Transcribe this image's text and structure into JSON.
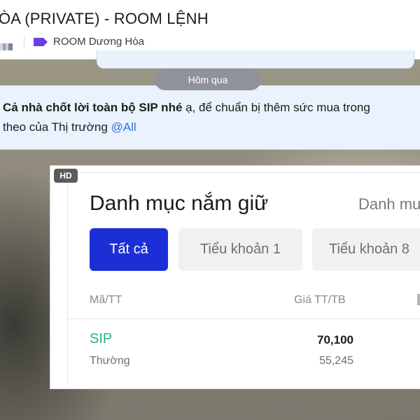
{
  "header": {
    "title": "ÒA (PRIVATE) - ROOM LỆNH",
    "room_name": "ROOM Dương Hòa",
    "tag_color": "#6c3fe0"
  },
  "chat": {
    "date_separator": "Hôm qua",
    "message": {
      "bold_text": "Cả nhà chốt lời toàn bộ SIP nhé",
      "text_after_bold": " ạ, để chuẩn bị thêm sức mua trong",
      "line2_text": "theo của Thị trường ",
      "mention": "@All"
    },
    "image": {
      "quality_badge": "HD",
      "portfolio": {
        "title": "Danh mục nắm giữ",
        "link_text": "Danh mu",
        "tabs": [
          {
            "label": "Tất cả",
            "active": true
          },
          {
            "label": "Tiểu khoản 1",
            "active": false
          },
          {
            "label": "Tiểu khoản 8",
            "active": false
          }
        ],
        "columns": {
          "code": "Mã/TT",
          "price": "Giá TT/TB"
        },
        "rows": [
          {
            "code": "SIP",
            "type": "Thường",
            "market_price": "70,100",
            "avg_price": "55,245"
          }
        ]
      }
    }
  },
  "colors": {
    "accent_blue": "#1c2fd6",
    "stock_green": "#26b483",
    "mention_blue": "#2f6fd8",
    "message_bg": "#eaf2fd"
  }
}
